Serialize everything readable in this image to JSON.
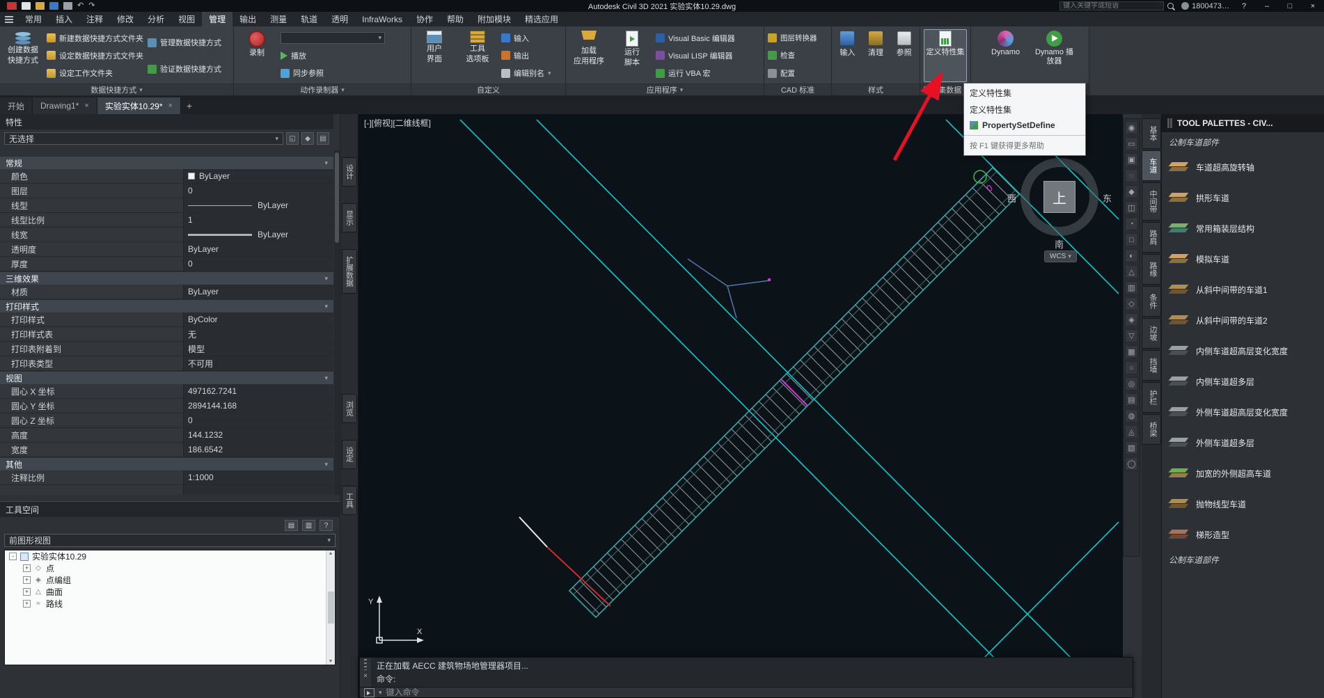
{
  "icons": {
    "chevron_down": "▾",
    "close": "×",
    "min": "–",
    "max": "□",
    "question": "?",
    "add": "+",
    "up": "▲",
    "down": "▼"
  },
  "titlebar": {
    "title": "Autodesk Civil 3D 2021  实验实体10.29.dwg",
    "search_placeholder": "键入关键字或短语",
    "user": "1800473…"
  },
  "menu_tabs": [
    {
      "label": "常用"
    },
    {
      "label": "插入"
    },
    {
      "label": "注释"
    },
    {
      "label": "修改"
    },
    {
      "label": "分析"
    },
    {
      "label": "视图"
    },
    {
      "label": "管理",
      "cls": "active"
    },
    {
      "label": "输出"
    },
    {
      "label": "测量"
    },
    {
      "label": "轨道"
    },
    {
      "label": "透明"
    },
    {
      "label": "InfraWorks"
    },
    {
      "label": "协作"
    },
    {
      "label": "帮助"
    },
    {
      "label": "附加模块"
    },
    {
      "label": "精选应用"
    }
  ],
  "ribbon": {
    "p1": {
      "title": "数据快捷方式",
      "big1": "创建数据",
      "big2": "快捷方式",
      "rows_a": [
        "新建数据快捷方式文件夹",
        "设定数据快捷方式文件夹",
        "设定工作文件夹"
      ],
      "rows_b": [
        "管理数据快捷方式",
        "验证数据快捷方式"
      ]
    },
    "p2": {
      "title": "动作录制器",
      "big": "录制",
      "play": "播放",
      "sync": "同步参照"
    },
    "p3": {
      "title": "自定义",
      "b1a": "用户",
      "b1b": "界面",
      "b2a": "工具",
      "b2b": "选项板",
      "rows": [
        "输入",
        "输出",
        "编辑别名"
      ]
    },
    "p4": {
      "title": "应用程序",
      "b1a": "加载",
      "b1b": "应用程序",
      "b2a": "运行",
      "b2b": "脚本",
      "rows": [
        "Visual Basic 编辑器",
        "Visual LISP 编辑器",
        "运行 VBA 宏"
      ]
    },
    "p5": {
      "title": "CAD 标准",
      "rows": [
        "图层转换器",
        "检查",
        "配置"
      ]
    },
    "p6": {
      "title": "样式",
      "items": [
        "输入",
        "清理",
        "参照"
      ]
    },
    "p7": {
      "title": "特性集数据",
      "big": "定义特性集"
    },
    "p8": {
      "items": [
        "Dynamo",
        "Dynamo 播放器"
      ]
    }
  },
  "tooltip": {
    "line1": "定义特性集",
    "line2": "定义特性集",
    "command": "PropertySetDefine",
    "footer": "按 F1 键获得更多帮助"
  },
  "file_tabs": {
    "start": "开始",
    "tabs": [
      {
        "label": "Drawing1*",
        "close": "×"
      },
      {
        "label": "实验实体10.29*",
        "close": "×",
        "cls": "active"
      }
    ],
    "add": "+"
  },
  "properties": {
    "header": "特性",
    "selector": "无选择",
    "sections": [
      {
        "name": "常规",
        "rows": [
          {
            "label": "颜色",
            "value": "ByLayer",
            "deco": "swatch"
          },
          {
            "label": "图层",
            "value": "0"
          },
          {
            "label": "线型",
            "value": "ByLayer",
            "deco": "line-thin"
          },
          {
            "label": "线型比例",
            "value": "1"
          },
          {
            "label": "线宽",
            "value": "ByLayer",
            "deco": "line-thick"
          },
          {
            "label": "透明度",
            "value": "ByLayer"
          },
          {
            "label": "厚度",
            "value": "0"
          }
        ]
      },
      {
        "name": "三维效果",
        "rows": [
          {
            "label": "材质",
            "value": "ByLayer"
          }
        ]
      },
      {
        "name": "打印样式",
        "rows": [
          {
            "label": "打印样式",
            "value": "ByColor"
          },
          {
            "label": "打印样式表",
            "value": "无"
          },
          {
            "label": "打印表附着到",
            "value": "模型"
          },
          {
            "label": "打印表类型",
            "value": "不可用"
          }
        ]
      },
      {
        "name": "视图",
        "rows": [
          {
            "label": "圆心 X 坐标",
            "value": "497162.7241"
          },
          {
            "label": "圆心 Y 坐标",
            "value": "2894144.168"
          },
          {
            "label": "圆心 Z 坐标",
            "value": "0"
          },
          {
            "label": "高度",
            "value": "144.1232"
          },
          {
            "label": "宽度",
            "value": "186.6542"
          }
        ]
      },
      {
        "name": "其他",
        "rows": [
          {
            "label": "注释比例",
            "value": "1:1000"
          }
        ]
      }
    ]
  },
  "side_tabs_upper": [
    "设计",
    "显示",
    "扩展数据"
  ],
  "side_tabs_lower": [
    "浏览",
    "设定",
    "工具"
  ],
  "toolspace": {
    "header": "工具空间",
    "toolbar_icons": [
      "▤",
      "▥",
      "?"
    ],
    "view_combo": "前图形视图",
    "tree": {
      "root": "实验实体10.29",
      "root_exp": "-",
      "children": [
        {
          "exp": "+",
          "glyph": "◇",
          "label": "点"
        },
        {
          "exp": "+",
          "glyph": "◈",
          "label": "点编组"
        },
        {
          "exp": "+",
          "glyph": "△",
          "label": "曲面"
        },
        {
          "exp": "+",
          "glyph": "≈",
          "label": "路线"
        }
      ]
    }
  },
  "canvas": {
    "viewport_label": "[-][俯视][二维线框]",
    "compass": {
      "up": "上",
      "west": "西",
      "east": "东",
      "south": "南"
    },
    "wcs": "WCS",
    "point_label": "0",
    "ucs": {
      "x": "X",
      "y": "Y"
    }
  },
  "nav_icons": [
    "◉",
    "▭",
    "▣",
    "◌",
    "◆",
    "◫",
    "◔",
    "□",
    "◐",
    "△",
    "▥",
    "◇",
    "◈",
    "▽",
    "▦",
    "○",
    "◎",
    "▤",
    "◍",
    "◬",
    "▧",
    "◯"
  ],
  "group_tabs": [
    {
      "label": "基本"
    },
    {
      "label": "车道",
      "cls": "active"
    },
    {
      "label": "中间带"
    },
    {
      "label": "路肩"
    },
    {
      "label": "路缘"
    },
    {
      "label": "条件"
    },
    {
      "label": "边坡"
    },
    {
      "label": "挡墙"
    },
    {
      "label": "护栏"
    },
    {
      "label": "桥梁"
    }
  ],
  "tool_palettes": {
    "title": "TOOL PALETTES - CIV...",
    "section_top": "公制车道部件",
    "section_bottom": "公制车道部件",
    "items": [
      {
        "label": "车道超高旋转轴",
        "icon": "road-tan"
      },
      {
        "label": "拱形车道",
        "icon": "road-tan"
      },
      {
        "label": "常用箱装层结构",
        "icon": "road-layers"
      },
      {
        "label": "模拟车道",
        "icon": "road-tan"
      },
      {
        "label": "从斜中间带的车道1",
        "icon": "road-tan2"
      },
      {
        "label": "从斜中间带的车道2",
        "icon": "road-tan2"
      },
      {
        "label": "内侧车道超高层变化宽度",
        "icon": "road-dark"
      },
      {
        "label": "内侧车道超多层",
        "icon": "road-dark"
      },
      {
        "label": "外侧车道超高层变化宽度",
        "icon": "road-dark"
      },
      {
        "label": "外侧车道超多层",
        "icon": "road-dark"
      },
      {
        "label": "加宽的外侧超高车道",
        "icon": "road-green"
      },
      {
        "label": "抛物线型车道",
        "icon": "road-tan2"
      },
      {
        "label": "梯形造型",
        "icon": "road-brown"
      }
    ]
  },
  "command": {
    "history": [
      "正在加载 AECC 建筑物场地管理器项目...",
      "命令:"
    ],
    "input_placeholder": "键入命令"
  },
  "colors": {
    "accent_cyan": "#00d9d9",
    "corridor_teal": "#2fb3b3",
    "annotation_red": "#e81123",
    "magenta": "#d23bd2"
  }
}
